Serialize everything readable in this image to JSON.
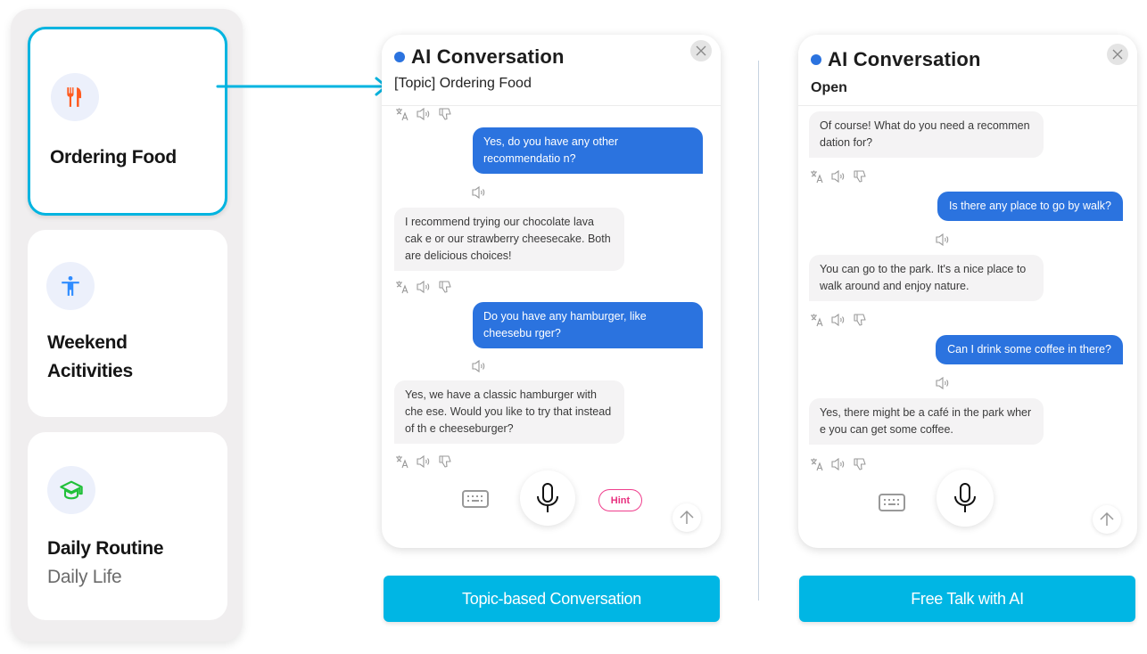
{
  "topics": [
    {
      "title": "Ordering Food",
      "subtitle": "",
      "icon": "fork-knife-icon",
      "icon_color": "#ff5a1f",
      "selected": true
    },
    {
      "title": "Weekend",
      "title2": "Acitivities",
      "subtitle": "",
      "icon": "person-arms-open-icon",
      "icon_color": "#2f8cff",
      "selected": false
    },
    {
      "title": "Daily Routine",
      "subtitle": "Daily Life",
      "icon": "graduation-cap-icon",
      "icon_color": "#22c03a",
      "selected": false
    }
  ],
  "topic_chat": {
    "title": "AI Conversation",
    "subtitle": "[Topic] Ordering Food",
    "messages": [
      {
        "role": "user",
        "text": "Yes, do you have any other recommendatio n?"
      },
      {
        "role": "ai",
        "text": "I recommend trying our chocolate lava cak e or our strawberry cheesecake. Both are delicious choices!"
      },
      {
        "role": "user",
        "text": "Do you have any hamburger, like cheesebu rger?"
      },
      {
        "role": "ai",
        "text": "Yes, we have a classic hamburger with che ese. Would you like to try that instead of th e cheeseburger?"
      }
    ],
    "hint_label": "Hint"
  },
  "free_chat": {
    "title": "AI Conversation",
    "subtitle": "Open",
    "messages": [
      {
        "role": "ai",
        "text": "Of course! What do you need a recommen dation for?"
      },
      {
        "role": "user",
        "text": "Is there any place to go by walk?"
      },
      {
        "role": "ai",
        "text": "You can go to the park. It's a nice place to walk around and enjoy nature."
      },
      {
        "role": "user",
        "text": "Can I drink some coffee in there?"
      },
      {
        "role": "ai",
        "text": "Yes, there might be a café in the park wher e you can get some coffee."
      }
    ]
  },
  "buttons": {
    "topic_based": "Topic-based Conversation",
    "free_talk": "Free Talk with AI"
  },
  "colors": {
    "accent": "#00b6e4",
    "user_bubble": "#2b73df",
    "ai_bubble": "#f4f3f4",
    "hint": "#ef3d8c"
  }
}
